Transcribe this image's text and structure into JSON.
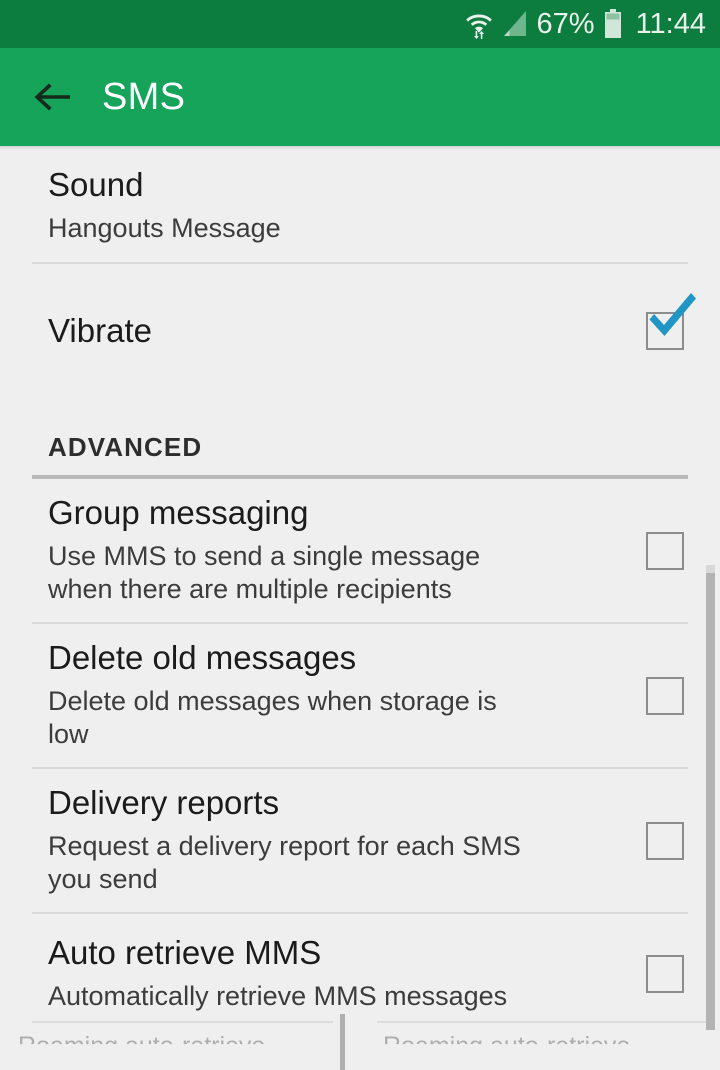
{
  "status_bar": {
    "wifi_icon": "wifi-with-transfer-arrows-icon",
    "signal_icon": "cellular-signal-icon",
    "battery_percent": "67%",
    "battery_icon": "battery-icon",
    "time": "11:44",
    "background_color": "#0d7c3f",
    "text_color": "#e8f3ec"
  },
  "app_bar": {
    "back_icon": "back-arrow-icon",
    "title": "SMS",
    "background_color": "#16a45b",
    "title_color": "#ffffff"
  },
  "settings": {
    "rows": [
      {
        "title": "Sound",
        "summary": "Hangouts Message",
        "widget": "none"
      },
      {
        "title": "Vibrate",
        "summary": "",
        "widget": "checkbox",
        "checked": true
      }
    ],
    "section": {
      "label": "ADVANCED",
      "rows": [
        {
          "title": "Group messaging",
          "summary": "Use MMS to send a single message when there are multiple recipients",
          "widget": "checkbox",
          "checked": false
        },
        {
          "title": "Delete old messages",
          "summary": "Delete old messages when storage is low",
          "widget": "checkbox",
          "checked": false
        },
        {
          "title": "Delivery reports",
          "summary": "Request a delivery report for each SMS you send",
          "widget": "checkbox",
          "checked": false
        },
        {
          "title": "Auto retrieve MMS",
          "summary": "Automatically retrieve MMS messages",
          "widget": "checkbox",
          "checked": false
        }
      ]
    },
    "clipped_row": {
      "title": "Roaming auto-retrieve"
    }
  },
  "colors": {
    "checkbox_checked": "#2196c4",
    "checkbox_border": "#8d8d8d",
    "list_background": "#efefef",
    "divider": "#dadada",
    "scrollbar": "#b3b3b3"
  }
}
